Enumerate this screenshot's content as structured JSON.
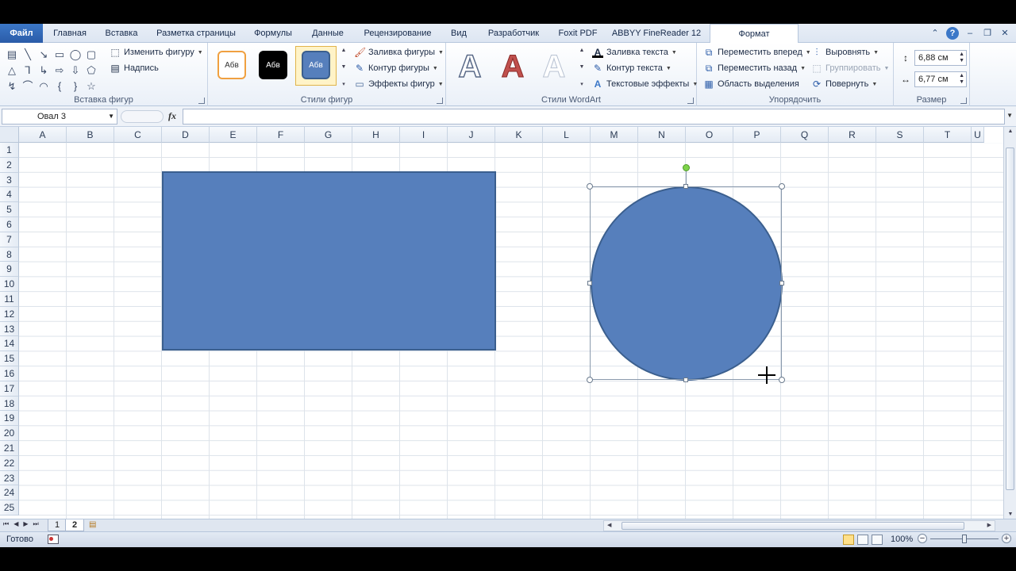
{
  "tabs": {
    "file": "Файл",
    "items": [
      "Главная",
      "Вставка",
      "Разметка страницы",
      "Формулы",
      "Данные",
      "Рецензирование",
      "Вид",
      "Разработчик",
      "Foxit PDF",
      "ABBYY FineReader 12"
    ],
    "active": "Формат"
  },
  "ribbon": {
    "insert_shapes": {
      "label": "Вставка фигур",
      "edit_shape": "Изменить фигуру",
      "textbox": "Надпись"
    },
    "shape_styles": {
      "label": "Стили фигур",
      "swatch_text": "Абв",
      "fill": "Заливка фигуры",
      "outline": "Контур фигуры",
      "effects": "Эффекты фигур"
    },
    "wordart": {
      "label": "Стили WordArt",
      "letter": "A",
      "text_fill": "Заливка текста",
      "text_outline": "Контур текста",
      "text_effects": "Текстовые эффекты"
    },
    "arrange": {
      "label": "Упорядочить",
      "bring_forward": "Переместить вперед",
      "send_backward": "Переместить назад",
      "selection_pane": "Область выделения",
      "align": "Выровнять",
      "group": "Группировать",
      "rotate": "Повернуть"
    },
    "size": {
      "label": "Размер",
      "height": "6,88 см",
      "width": "6,77 см"
    }
  },
  "formula_bar": {
    "name_box": "Овал 3",
    "fx": "fx",
    "value": ""
  },
  "columns": [
    "A",
    "B",
    "C",
    "D",
    "E",
    "F",
    "G",
    "H",
    "I",
    "J",
    "K",
    "L",
    "M",
    "N",
    "O",
    "P",
    "Q",
    "R",
    "S",
    "T",
    "U"
  ],
  "rows": [
    "1",
    "2",
    "3",
    "4",
    "5",
    "6",
    "7",
    "8",
    "9",
    "10",
    "11",
    "12",
    "13",
    "14",
    "15",
    "16",
    "17",
    "18",
    "19",
    "20",
    "21",
    "22",
    "23",
    "24",
    "25"
  ],
  "shapes": {
    "fill_color": "#567fbc",
    "outline_color": "#3b5f8e"
  },
  "sheets": {
    "items": [
      "1",
      "2"
    ],
    "active": "2"
  },
  "status": {
    "ready": "Готово",
    "zoom": "100%"
  }
}
